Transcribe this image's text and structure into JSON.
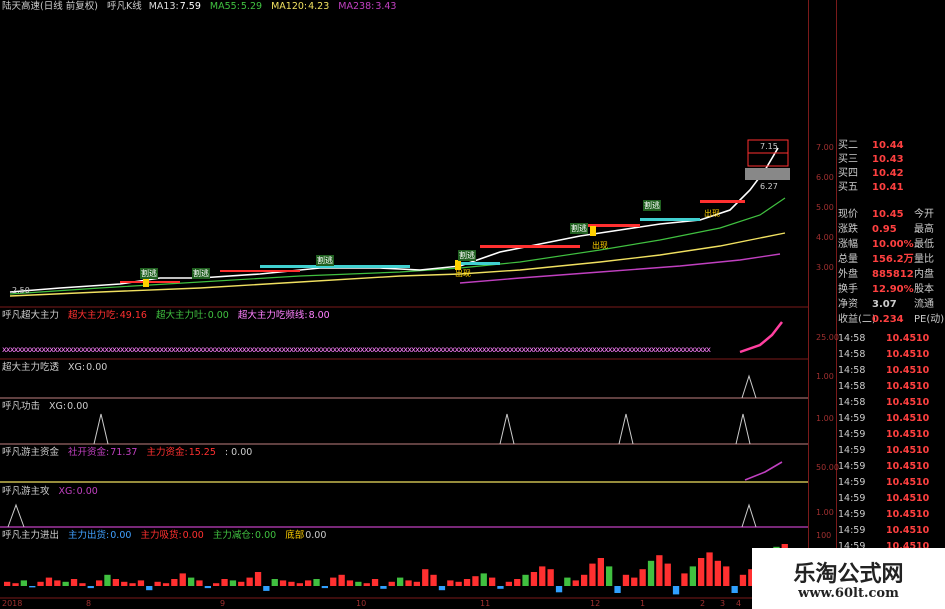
{
  "main_header": {
    "stock": "陆天高速(日线 前复权)",
    "indicator": "呼凡K线",
    "ma13_label": "MA13:",
    "ma13": "7.59",
    "ma55_label": "MA55:",
    "ma55": "5.29",
    "ma120_label": "MA120:",
    "ma120": "4.23",
    "ma238_label": "MA238:",
    "ma238": "3.43"
  },
  "price_axis": [
    "7.00",
    "6.00",
    "5.00",
    "4.00",
    "3.00"
  ],
  "price_callouts": [
    "7.15",
    "6.27"
  ],
  "price_low_label": "2.50",
  "chart_markers": [
    "割逃",
    "割逃",
    "割逃",
    "割逃",
    "割逃",
    "割逃",
    "出现",
    "出现",
    "出现"
  ],
  "panel1": {
    "title": "呼凡超大主力",
    "l1": "超大主力吃:",
    "v1": "49.16",
    "l2": "超大主力吐:",
    "v2": "0.00",
    "l3": "超大主力吃频线:",
    "v3": "8.00",
    "axis": "25.00"
  },
  "panel2": {
    "title": "超大主力吃透",
    "l1": "XG:",
    "v1": "0.00",
    "axis": "1.00"
  },
  "panel3": {
    "title": "呼凡功击",
    "l1": "XG:",
    "v1": "0.00",
    "axis": "1.00"
  },
  "panel4": {
    "title": "呼凡游主资金",
    "l1": "社开资金:",
    "v1": "71.37",
    "l2": "主力资金:",
    "v2": "15.25",
    "v3": ": 0.00",
    "axis": "50.00"
  },
  "panel5": {
    "title": "呼凡游主攻",
    "l1": "XG:",
    "v1": "0.00",
    "axis": "1.00"
  },
  "panel6": {
    "title": "呼凡主力进出",
    "l1": "主力出货:",
    "v1": "0.00",
    "l2": "主力吸货:",
    "v2": "0.00",
    "l3": "主力减仓:",
    "v3": "0.00",
    "l4": "底部",
    "v4": "0.00",
    "axis": "100"
  },
  "date_axis": [
    "2018",
    "8",
    "9",
    "10",
    "11",
    "12",
    "1",
    "2",
    "3",
    "4"
  ],
  "quote": {
    "buy": [
      {
        "label": "买二",
        "value": "10.44"
      },
      {
        "label": "买三",
        "value": "10.43"
      },
      {
        "label": "买四",
        "value": "10.42"
      },
      {
        "label": "买五",
        "value": "10.41"
      }
    ],
    "rows": [
      {
        "l": "现价",
        "v": "10.45",
        "r": "今开"
      },
      {
        "l": "涨跌",
        "v": "0.95",
        "r": "最高"
      },
      {
        "l": "涨幅",
        "v": "10.00%",
        "r": "最低"
      },
      {
        "l": "总量",
        "v": "156.2万",
        "r": "量比"
      },
      {
        "l": "外盘",
        "v": "885812",
        "r": "内盘"
      },
      {
        "l": "换手",
        "v": "12.90%",
        "r": "股本"
      },
      {
        "l": "净资",
        "v": "3.07",
        "r": "流通"
      },
      {
        "l": "收益(二)",
        "v": "0.234",
        "r": "PE(动)"
      }
    ],
    "ticks": [
      {
        "t": "14:58",
        "p": "10.45",
        "v": "10"
      },
      {
        "t": "14:58",
        "p": "10.45",
        "v": "10"
      },
      {
        "t": "14:58",
        "p": "10.45",
        "v": "10"
      },
      {
        "t": "14:58",
        "p": "10.45",
        "v": "10"
      },
      {
        "t": "14:58",
        "p": "10.45",
        "v": "10"
      },
      {
        "t": "14:59",
        "p": "10.45",
        "v": "10"
      },
      {
        "t": "14:59",
        "p": "10.45",
        "v": "10"
      },
      {
        "t": "14:59",
        "p": "10.45",
        "v": "10"
      },
      {
        "t": "14:59",
        "p": "10.45",
        "v": "10"
      },
      {
        "t": "14:59",
        "p": "10.45",
        "v": "10"
      },
      {
        "t": "14:59",
        "p": "10.45",
        "v": "10"
      },
      {
        "t": "14:59",
        "p": "10.45",
        "v": "10"
      },
      {
        "t": "14:59",
        "p": "10.45",
        "v": "10"
      },
      {
        "t": "14:59",
        "p": "10.45",
        "v": "10"
      },
      {
        "t": "14:59",
        "p": "10.45",
        "v": "10"
      },
      {
        "t": "14:59",
        "p": "10.45",
        "v": "10"
      }
    ]
  },
  "watermark": {
    "cn": "乐淘公式网",
    "url": "www.60lt.com"
  },
  "colors": {
    "up": "#ff3030",
    "down": "#00d0ff",
    "ma13": "#ffffff",
    "ma55": "#40c040",
    "ma120": "#f0e060",
    "ma238": "#c040c0",
    "grid": "#7a1a1a"
  }
}
